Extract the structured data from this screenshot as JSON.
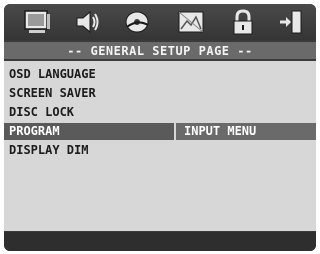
{
  "title": "-- GENERAL SETUP PAGE --",
  "icons": [
    "monitor-icon",
    "speaker-icon",
    "disc-icon",
    "picture-icon",
    "lock-icon",
    "exit-icon"
  ],
  "menu": {
    "items": [
      {
        "label": "OSD LANGUAGE",
        "selected": false
      },
      {
        "label": "SCREEN SAVER",
        "selected": false
      },
      {
        "label": "DISC LOCK",
        "selected": false
      },
      {
        "label": "PROGRAM",
        "selected": true
      },
      {
        "label": "DISPLAY DIM",
        "selected": false
      }
    ]
  },
  "submenu": {
    "label": "INPUT MENU"
  },
  "colors": {
    "menu_bg": "#d7d7d7",
    "highlight": "#5a5a5a",
    "title_bar": "#6a6a6a",
    "frame": "#3a3a3a"
  }
}
